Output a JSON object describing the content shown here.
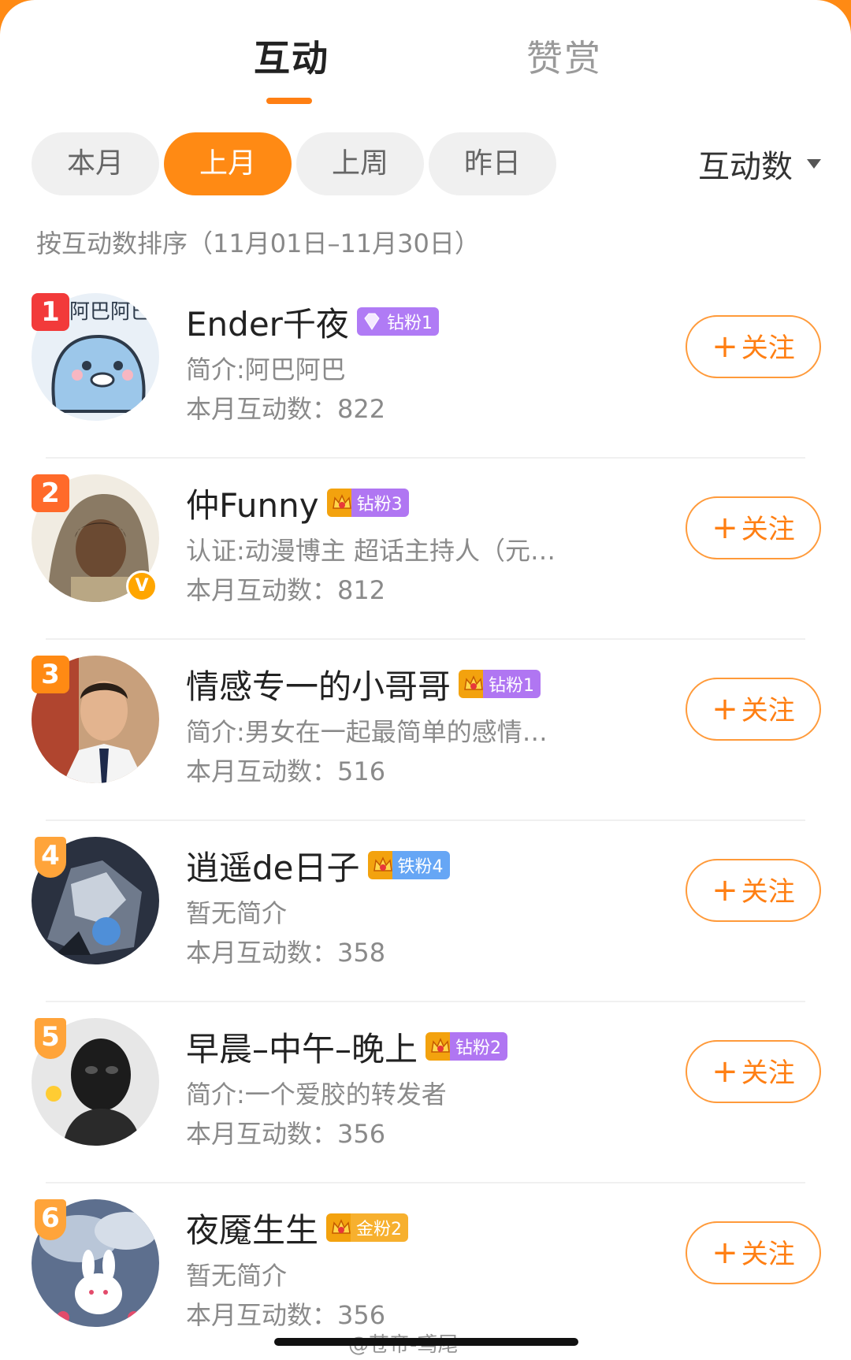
{
  "tabs": {
    "active": "互动",
    "inactive": "赞赏"
  },
  "filters": {
    "items": [
      "本月",
      "上月",
      "上周",
      "昨日"
    ],
    "selected": "上月"
  },
  "sort": {
    "label": "互动数"
  },
  "sort_desc": "按互动数排序（11月01日–11月30日）",
  "count_prefix": "本月互动数：",
  "follow_label": "关注",
  "users": [
    {
      "rank": "1",
      "name": "Ender千夜",
      "badge": "钻粉1",
      "bio": "简介:阿巴阿巴",
      "count": "822"
    },
    {
      "rank": "2",
      "name": "仲Funny",
      "badge": "钻粉3",
      "bio": "认证:动漫博主 超话主持人（元…",
      "count": "812"
    },
    {
      "rank": "3",
      "name": "情感专一的小哥哥",
      "badge": "钻粉1",
      "bio": "简介:男女在一起最简单的感情…",
      "count": "516"
    },
    {
      "rank": "4",
      "name": "逍遥de日子",
      "badge": "铁粉4",
      "bio": "暂无简介",
      "count": "358"
    },
    {
      "rank": "5",
      "name": "早晨–中午–晚上",
      "badge": "钻粉2",
      "bio": "简介:一个爱胶的转发者",
      "count": "356"
    },
    {
      "rank": "6",
      "name": "夜魇生生",
      "badge": "金粉2",
      "bio": "暂无简介",
      "count": "356"
    }
  ],
  "watermark": "@苍帝-鸢尾",
  "colors": {
    "accent": "#ff8a14",
    "rank1": "#f23a3a",
    "text": "#222222",
    "muted": "#8a8a8a"
  }
}
